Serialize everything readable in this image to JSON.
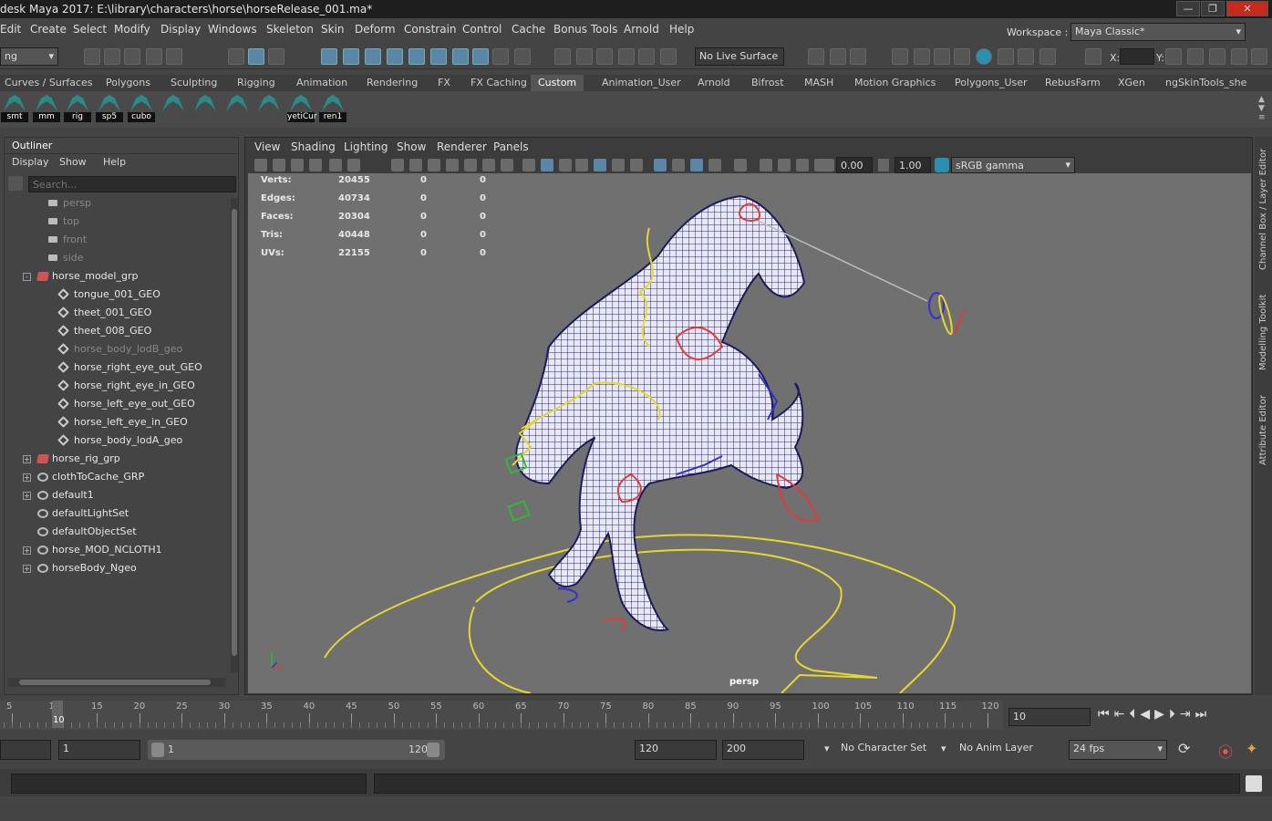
{
  "window": {
    "title": "desk Maya 2017: E:\\library\\characters\\horse\\horseRelease_001.ma*"
  },
  "menubar": [
    "Edit",
    "Create",
    "Select",
    "Modify",
    "Display",
    "Windows",
    "Skeleton",
    "Skin",
    "Deform",
    "Constrain",
    "Control",
    "Cache",
    "Bonus Tools",
    "Arnold",
    "Help"
  ],
  "workspace": {
    "label": "Workspace :",
    "value": "Maya Classic*"
  },
  "statusline": {
    "mode_value": "ng",
    "live_surface": "No Live Surface",
    "x_label": "X:",
    "y_label": "Y:"
  },
  "shelf_tabs": [
    "Curves / Surfaces",
    "Polygons",
    "Sculpting",
    "Rigging",
    "Animation",
    "Rendering",
    "FX",
    "FX Caching",
    "Custom",
    "Animation_User",
    "Arnold",
    "Bifrost",
    "MASH",
    "Motion Graphics",
    "Polygons_User",
    "RebusFarm",
    "XGen",
    "ngSkinTools_she"
  ],
  "active_shelf_tab": "Custom",
  "shelf_buttons": [
    "smt",
    "mm",
    "rig",
    "sp5",
    "cubo",
    "",
    "",
    "",
    "",
    "yetiCur",
    "ren1"
  ],
  "outliner": {
    "title": "Outliner",
    "menu": [
      "Display",
      "Show",
      "Help"
    ],
    "search_placeholder": "Search...",
    "items": [
      {
        "label": "persp",
        "dim": true,
        "icon": "camera-icon"
      },
      {
        "label": "top",
        "dim": true,
        "icon": "camera-icon"
      },
      {
        "label": "front",
        "dim": true,
        "icon": "camera-icon"
      },
      {
        "label": "side",
        "dim": true,
        "icon": "camera-icon"
      },
      {
        "label": "horse_model_grp",
        "icon": "group-icon",
        "expand": "-"
      },
      {
        "label": "tongue_001_GEO",
        "icon": "mesh-icon"
      },
      {
        "label": "theet_001_GEO",
        "icon": "mesh-icon"
      },
      {
        "label": "theet_008_GEO",
        "icon": "mesh-icon"
      },
      {
        "label": "horse_body_lodB_geo",
        "dim": true,
        "icon": "mesh-icon"
      },
      {
        "label": "horse_right_eye_out_GEO",
        "icon": "mesh-icon"
      },
      {
        "label": "horse_right_eye_in_GEO",
        "icon": "mesh-icon"
      },
      {
        "label": "horse_left_eye_out_GEO",
        "icon": "mesh-icon"
      },
      {
        "label": "horse_left_eye_in_GEO",
        "icon": "mesh-icon"
      },
      {
        "label": "horse_body_lodA_geo",
        "icon": "mesh-icon"
      },
      {
        "label": "horse_rig_grp",
        "icon": "group-icon",
        "expand": "+"
      },
      {
        "label": "clothToCache_GRP",
        "icon": "set-icon",
        "expand": "+"
      },
      {
        "label": "default1",
        "icon": "set-icon",
        "expand": "+"
      },
      {
        "label": "defaultLightSet",
        "icon": "set-icon"
      },
      {
        "label": "defaultObjectSet",
        "icon": "set-icon"
      },
      {
        "label": "horse_MOD_NCLOTH1",
        "icon": "set-icon",
        "expand": "+"
      },
      {
        "label": "horseBody_Ngeo",
        "icon": "set-icon",
        "expand": "+"
      }
    ]
  },
  "viewport": {
    "menu": [
      "View",
      "Shading",
      "Lighting",
      "Show",
      "Renderer",
      "Panels"
    ],
    "exposure": "0.00",
    "gamma": "1.00",
    "colorspace": "sRGB gamma",
    "camera_label": "persp",
    "stats": [
      {
        "label": "Verts:",
        "v": "20455",
        "a": "0",
        "b": "0"
      },
      {
        "label": "Edges:",
        "v": "40734",
        "a": "0",
        "b": "0"
      },
      {
        "label": "Faces:",
        "v": "20304",
        "a": "0",
        "b": "0"
      },
      {
        "label": "Tris:",
        "v": "40448",
        "a": "0",
        "b": "0"
      },
      {
        "label": "UVs:",
        "v": "22155",
        "a": "0",
        "b": "0"
      }
    ]
  },
  "right_panels": [
    "Channel Box / Layer Editor",
    "Modelling Toolkit",
    "Attribute Editor"
  ],
  "timeline": {
    "ticks": [
      "5",
      "10",
      "15",
      "20",
      "25",
      "30",
      "35",
      "40",
      "45",
      "50",
      "55",
      "60",
      "65",
      "70",
      "75",
      "80",
      "85",
      "90",
      "95",
      "100",
      "105",
      "110",
      "115",
      "120"
    ],
    "current_frame": "10",
    "current_frame_field": "10"
  },
  "range": {
    "start": "1",
    "range_start": "1",
    "range_end": "120",
    "end": "120",
    "anim_end": "200",
    "character_set": "No Character Set",
    "anim_layer": "No Anim Layer",
    "fps": "24 fps"
  }
}
